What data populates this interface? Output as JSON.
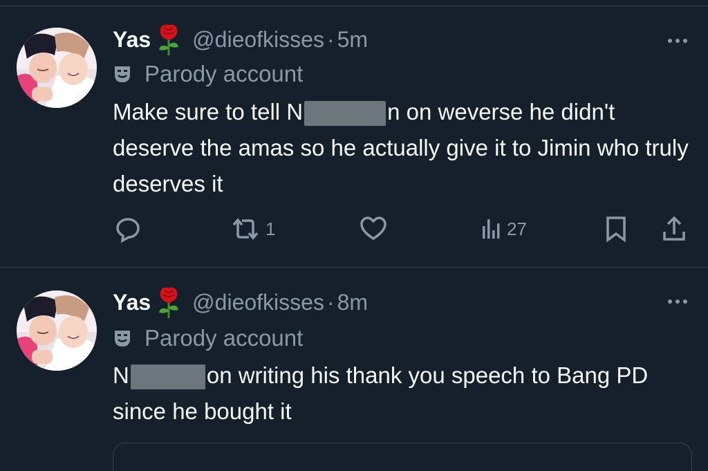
{
  "tweets": [
    {
      "name": "Yas",
      "handle": "@dieofkisses",
      "separator": "·",
      "time": "5m",
      "label": "Parody account",
      "text_parts": [
        "Make sure to tell N",
        "n on weverse he didn't deserve the amas so he actually give it to Jimin who truly deserves it"
      ],
      "stats": {
        "retweets": "1",
        "views": "27"
      }
    },
    {
      "name": "Yas",
      "handle": "@dieofkisses",
      "separator": "·",
      "time": "8m",
      "label": "Parody account",
      "text_parts": [
        "N",
        "on writing his thank you speech to Bang PD since he bought it"
      ]
    }
  ],
  "icons": {
    "name_emoji": "rose-icon",
    "label_icon": "parody-mask-icon",
    "more": "more-icon",
    "reply": "reply-icon",
    "retweet": "retweet-icon",
    "like": "like-icon",
    "views": "views-icon",
    "bookmark": "bookmark-icon",
    "share": "share-icon"
  },
  "colors": {
    "background": "#15202b",
    "text": "#f7f9f9",
    "secondary": "#8b98a5",
    "divider": "#38444d"
  }
}
